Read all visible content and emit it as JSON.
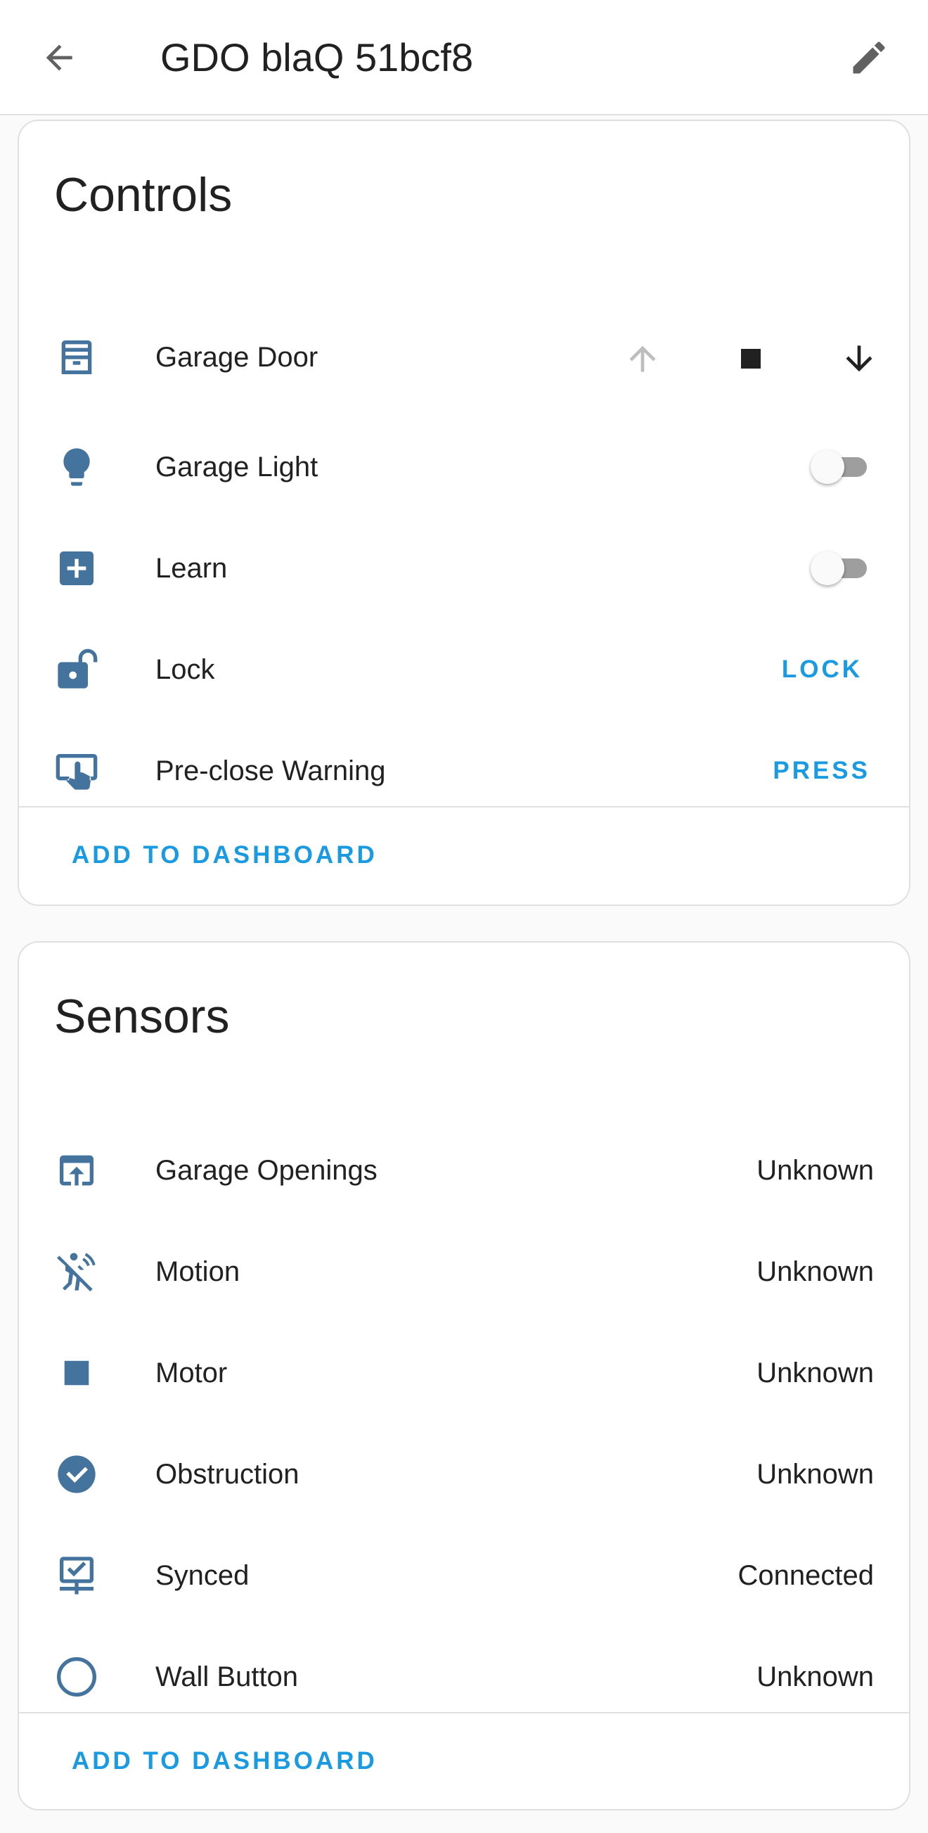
{
  "header": {
    "title": "GDO blaQ 51bcf8",
    "back_icon": "arrow-left-icon",
    "edit_icon": "pencil-icon"
  },
  "colors": {
    "accent": "#1a9ae0",
    "icon": "#44739e",
    "card_bg": "#ffffff",
    "page_bg": "#fafafa"
  },
  "controls": {
    "title": "Controls",
    "items": [
      {
        "label": "Garage Door",
        "icon": "garage-icon",
        "actions": [
          "arrow-up-icon",
          "stop-icon",
          "arrow-down-icon"
        ]
      },
      {
        "label": "Garage Light",
        "icon": "lightbulb-icon",
        "toggle_on": false
      },
      {
        "label": "Learn",
        "icon": "plus-box-icon",
        "toggle_on": false
      },
      {
        "label": "Lock",
        "icon": "lock-open-icon",
        "action": "LOCK"
      },
      {
        "label": "Pre-close Warning",
        "icon": "gesture-tap-box-icon",
        "action": "PRESS"
      }
    ],
    "add_to_dashboard": "ADD TO DASHBOARD"
  },
  "sensors": {
    "title": "Sensors",
    "items": [
      {
        "label": "Garage Openings",
        "icon": "open-in-app-icon",
        "value": "Unknown"
      },
      {
        "label": "Motion",
        "icon": "motion-sensor-off-icon",
        "value": "Unknown"
      },
      {
        "label": "Motor",
        "icon": "square-icon",
        "value": "Unknown"
      },
      {
        "label": "Obstruction",
        "icon": "check-circle-icon",
        "value": "Unknown"
      },
      {
        "label": "Synced",
        "icon": "lan-check-icon",
        "value": "Connected"
      },
      {
        "label": "Wall Button",
        "icon": "circle-outline-icon",
        "value": "Unknown"
      }
    ],
    "add_to_dashboard": "ADD TO DASHBOARD"
  }
}
